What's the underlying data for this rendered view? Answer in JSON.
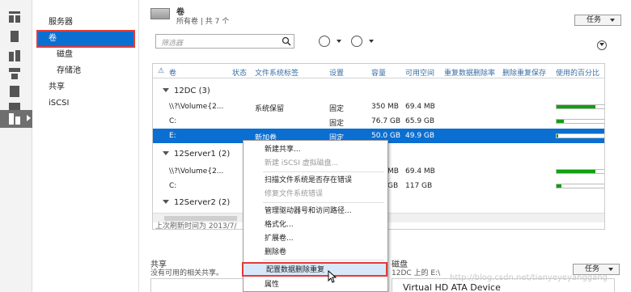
{
  "rail": {
    "icons": [
      "dashboard-icon",
      "local-server-icon",
      "all-servers-icon",
      "file-services-icon",
      "iis-icon",
      "roles-icon",
      "storage-icon"
    ]
  },
  "nav": {
    "items": [
      "服务器",
      "卷",
      "磁盘",
      "存储池",
      "共享",
      "iSCSI"
    ]
  },
  "volumes": {
    "title": "卷",
    "subtitle": "所有卷 | 共 7 个",
    "tasks": "任务",
    "filter_placeholder": "筛选器",
    "columns": [
      "卷",
      "状态",
      "文件系统标签",
      "设置",
      "容量",
      "可用空间",
      "重复数据删除率",
      "删除重复保存",
      "使用的百分比"
    ],
    "groups": [
      {
        "label": "12DC (3)"
      },
      {
        "label": "12Server1 (2)"
      },
      {
        "label": "12Server2 (2)"
      }
    ],
    "rows": [
      {
        "volume": "\\\\?\\Volume{2...",
        "label": "系统保留",
        "setting": "固定",
        "capacity": "350 MB",
        "free": "69.4 MB",
        "used_pct": 80
      },
      {
        "volume": "C:",
        "label": "",
        "setting": "固定",
        "capacity": "76.7 GB",
        "free": "65.9 GB",
        "used_pct": 15
      },
      {
        "volume": "E:",
        "label": "新加卷",
        "setting": "固定",
        "capacity": "50.0 GB",
        "free": "49.9 GB",
        "used_pct": 1
      },
      {
        "volume": "\\\\?\\Volume{2...",
        "label": "",
        "setting": "",
        "capacity": "MB",
        "free": "69.4 MB",
        "used_pct": 80
      },
      {
        "volume": "C:",
        "label": "",
        "setting": "",
        "capacity": "GB",
        "free": "117 GB",
        "used_pct": 10
      }
    ],
    "last_refresh": "上次刷新时间为 2013/7/"
  },
  "context_menu": {
    "items": [
      {
        "label": "新建共享...",
        "enabled": true
      },
      {
        "label": "新建 iSCSI 虚拟磁盘...",
        "enabled": false
      },
      {
        "label": "扫描文件系统是否存在错误",
        "enabled": true
      },
      {
        "label": "修复文件系统错误",
        "enabled": false
      },
      {
        "label": "管理驱动器号和访问路径...",
        "enabled": true
      },
      {
        "label": "格式化...",
        "enabled": true
      },
      {
        "label": "扩展卷...",
        "enabled": true
      },
      {
        "label": "删除卷",
        "enabled": true
      },
      {
        "label": "配置数据删除重复",
        "enabled": true
      },
      {
        "label": "属性",
        "enabled": true
      }
    ]
  },
  "shares": {
    "title": "共享",
    "subtitle": "没有可用的相关共享。"
  },
  "disk": {
    "title": "磁盘",
    "subtitle": "12DC 上的 E:\\",
    "tasks": "任务",
    "device": "Virtual HD ATA Device"
  },
  "watermark": "http://blog.csdn.net/tianyeyeyanggang",
  "colors": {
    "selection": "#0b6ed1",
    "highlight_border": "#e33b3b",
    "usage_bar": "#10a010",
    "header_text": "#3a6ea5"
  }
}
